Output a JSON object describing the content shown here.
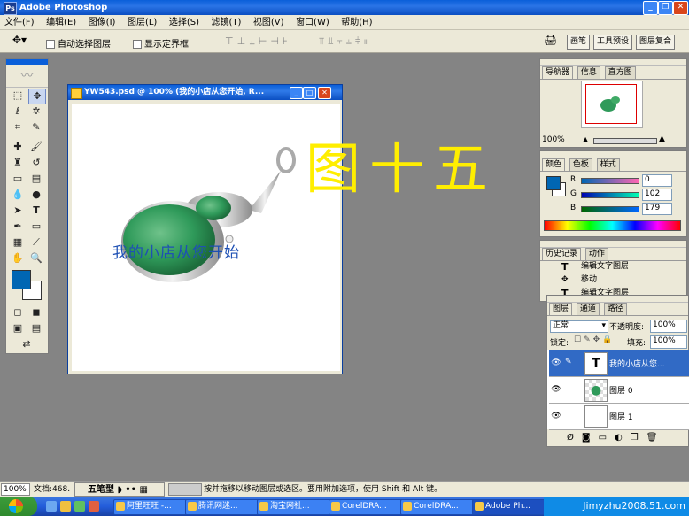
{
  "app": {
    "title": "Adobe Photoshop",
    "menus": [
      "文件(F)",
      "编辑(E)",
      "图像(I)",
      "图层(L)",
      "选择(S)",
      "滤镜(T)",
      "视图(V)",
      "窗口(W)",
      "帮助(H)"
    ]
  },
  "options": {
    "auto_select_label": "自动选择图层",
    "show_bounds_label": "显示定界框",
    "wells": [
      "画笔",
      "工具预设",
      "图层复合"
    ]
  },
  "document": {
    "title": "YW543.psd @ 100% (我的小店从您开始, R...",
    "overlay_text": "我的小店从您开始"
  },
  "big_text": "图十五",
  "navigator": {
    "tabs": [
      "导航器",
      "信息",
      "直方图"
    ],
    "zoom": "100%"
  },
  "color": {
    "tabs": [
      "颜色",
      "色板",
      "样式"
    ],
    "r_label": "R",
    "r_value": "0",
    "g_label": "G",
    "g_value": "102",
    "b_label": "B",
    "b_value": "179",
    "foreground": "#0066b3"
  },
  "history": {
    "tabs": [
      "历史记录",
      "动作"
    ],
    "items": [
      "编辑文字图层",
      "移动",
      "编辑文字图层"
    ]
  },
  "layers": {
    "tabs": [
      "图层",
      "通道",
      "路径"
    ],
    "blend_mode": "正常",
    "opacity_label": "不透明度:",
    "opacity_value": "100%",
    "lock_label": "锁定:",
    "fill_label": "填充:",
    "fill_value": "100%",
    "items": [
      {
        "name": "我的小店从您...",
        "selected": true
      },
      {
        "name": "图层 0",
        "selected": false
      },
      {
        "name": "图层 1",
        "selected": false
      }
    ]
  },
  "status": {
    "zoom": "100%",
    "doc_info": "文档:468.",
    "ime_label": "五笔型",
    "hint": "按并拖移以移动图层或选区。要用附加选项，使用 Shift 和 Alt 键。"
  },
  "taskbar": {
    "tasks": [
      "阿里旺旺 -...",
      "腾讯网迷...",
      "淘宝网社...",
      "CorelDRA...",
      "CorelDRA...",
      "Adobe Ph..."
    ],
    "watermark": "Jimyzhu2008.51.com"
  }
}
